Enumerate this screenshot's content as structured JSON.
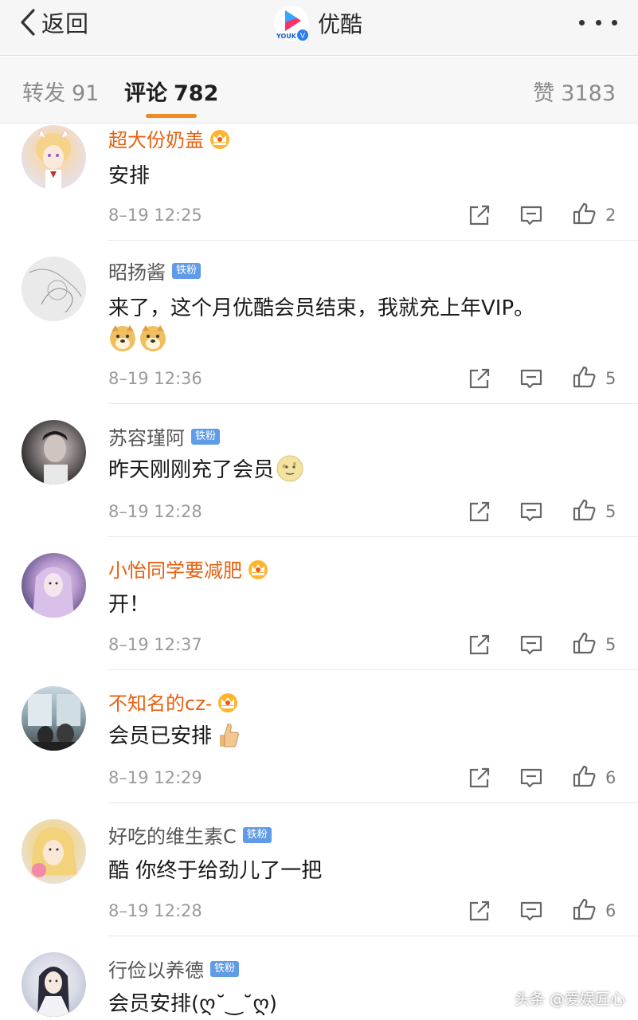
{
  "nav": {
    "back_label": "返回",
    "brand_name": "优酷",
    "logo_text": "YOUK"
  },
  "tabs": [
    {
      "label": "转发",
      "count": "91"
    },
    {
      "label": "评论",
      "count": "782"
    },
    {
      "label": "赞",
      "count": "3183"
    }
  ],
  "colors": {
    "accent_orange": "#f08a24",
    "vip_name": "#e8600f",
    "fan_badge": "#5f9be6"
  },
  "fan_badge_label": "铁粉",
  "comments": [
    {
      "user": "超大份奶盖",
      "vip": true,
      "badge": "crown",
      "text": "安排",
      "time": "8–19 12:25",
      "likes": "2",
      "avatar_style": "anime-girl"
    },
    {
      "user": "昭扬酱",
      "vip": false,
      "badge": "fan",
      "text": "来了，这个月优酷会员结束，我就充上年VIP。",
      "emoji_line": [
        "doge-emoji",
        "doge-emoji"
      ],
      "time": "8–19 12:36",
      "likes": "5",
      "avatar_style": "sketch"
    },
    {
      "user": "苏容瑾阿",
      "vip": false,
      "badge": "fan",
      "text": "昨天刚刚充了会员",
      "inline_emoji": "moon-face-emoji",
      "time": "8–19 12:28",
      "likes": "5",
      "avatar_style": "bw-portrait"
    },
    {
      "user": "小怡同学要减肥",
      "vip": true,
      "badge": "crown",
      "text": "开！",
      "time": "8–19 12:37",
      "likes": "5",
      "avatar_style": "purple-portrait"
    },
    {
      "user": "不知名的cz-",
      "vip": true,
      "badge": "crown",
      "text": "会员已安排",
      "inline_emoji": "thumbs-up-emoji",
      "time": "8–19 12:29",
      "likes": "6",
      "avatar_style": "window-scene"
    },
    {
      "user": "好吃的维生素C",
      "vip": false,
      "badge": "fan",
      "text": "酷 你终于给劲儿了一把",
      "time": "8–19 12:28",
      "likes": "6",
      "avatar_style": "anime-blonde"
    },
    {
      "user": "行俭以养德",
      "vip": false,
      "badge": "fan",
      "text": "会员安排(ღ˘‿˘ღ)",
      "avatar_style": "costume-portrait"
    }
  ],
  "watermark": "头条 @爱娱匠心"
}
